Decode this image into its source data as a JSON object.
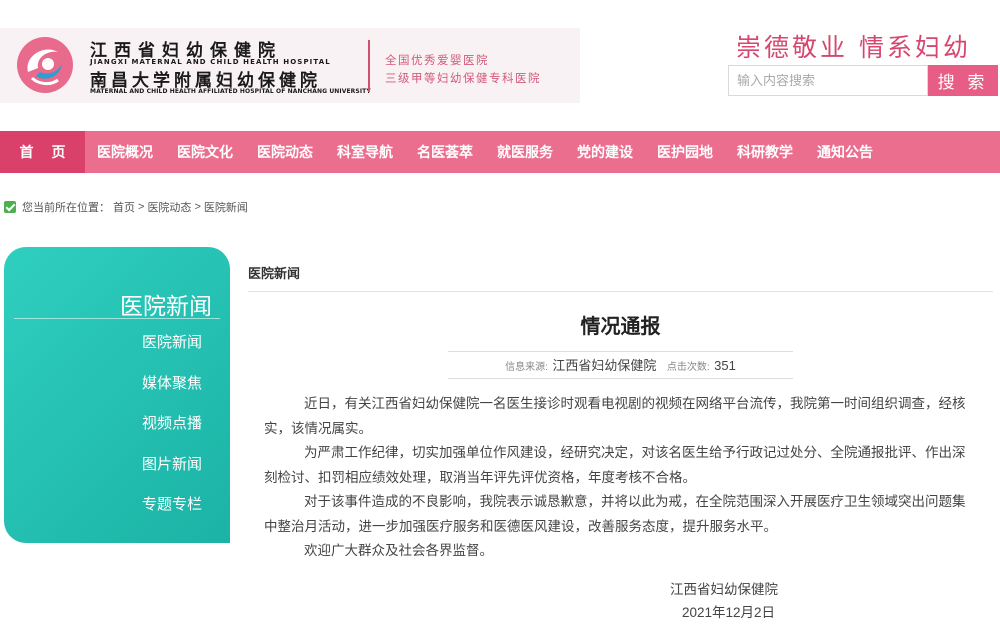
{
  "header": {
    "hospital_name_cn": "江西省妇幼保健院",
    "hospital_name_en": "JIANGXI MATERNAL AND CHILD HEALTH HOSPITAL",
    "affiliated_name_cn": "南昌大学附属妇幼保健院",
    "affiliated_name_en": "MATERNAL AND CHILD HEALTH AFFILIATED HOSPITAL OF NANCHANG UNIVERSITY",
    "honor_1": "全国优秀爱婴医院",
    "honor_2": "三级甲等妇幼保健专科医院",
    "slogan": "崇德敬业 情系妇幼",
    "search_placeholder": "输入内容搜索",
    "search_button": "搜 索",
    "brand_color": "#ec6e8e"
  },
  "nav": {
    "home": "首页",
    "items": [
      "医院概况",
      "医院文化",
      "医院动态",
      "科室导航",
      "名医荟萃",
      "就医服务",
      "党的建设",
      "医护园地",
      "科研教学",
      "通知公告"
    ]
  },
  "breadcrumb": {
    "prefix": "您当前所在位置：",
    "items": [
      "首页",
      "医院动态",
      "医院新闻"
    ],
    "separator": ">"
  },
  "sidebar": {
    "title": "医院新闻",
    "items": [
      "医院新闻",
      "媒体聚焦",
      "视频点播",
      "图片新闻",
      "专题专栏"
    ],
    "color": "#22bfb1"
  },
  "main": {
    "section_title": "医院新闻",
    "article": {
      "title": "情况通报",
      "source_label": "信息来源:",
      "source": "江西省妇幼保健院",
      "hits_label": "点击次数:",
      "hits": "351",
      "paragraphs": [
        "近日，有关江西省妇幼保健院一名医生接诊时观看电视剧的视频在网络平台流传，我院第一时间组织调查，经核实，该情况属实。",
        "为严肃工作纪律，切实加强单位作风建设，经研究决定，对该名医生给予行政记过处分、全院通报批评、作出深刻检讨、扣罚相应绩效处理，取消当年评先评优资格，年度考核不合格。",
        "对于该事件造成的不良影响，我院表示诚恳歉意，并将以此为戒，在全院范围深入开展医疗卫生领域突出问题集中整治月活动，进一步加强医疗服务和医德医风建设，改善服务态度，提升服务水平。",
        "欢迎广大群众及社会各界监督。"
      ],
      "signature": "江西省妇幼保健院",
      "date": "2021年12月2日"
    }
  }
}
